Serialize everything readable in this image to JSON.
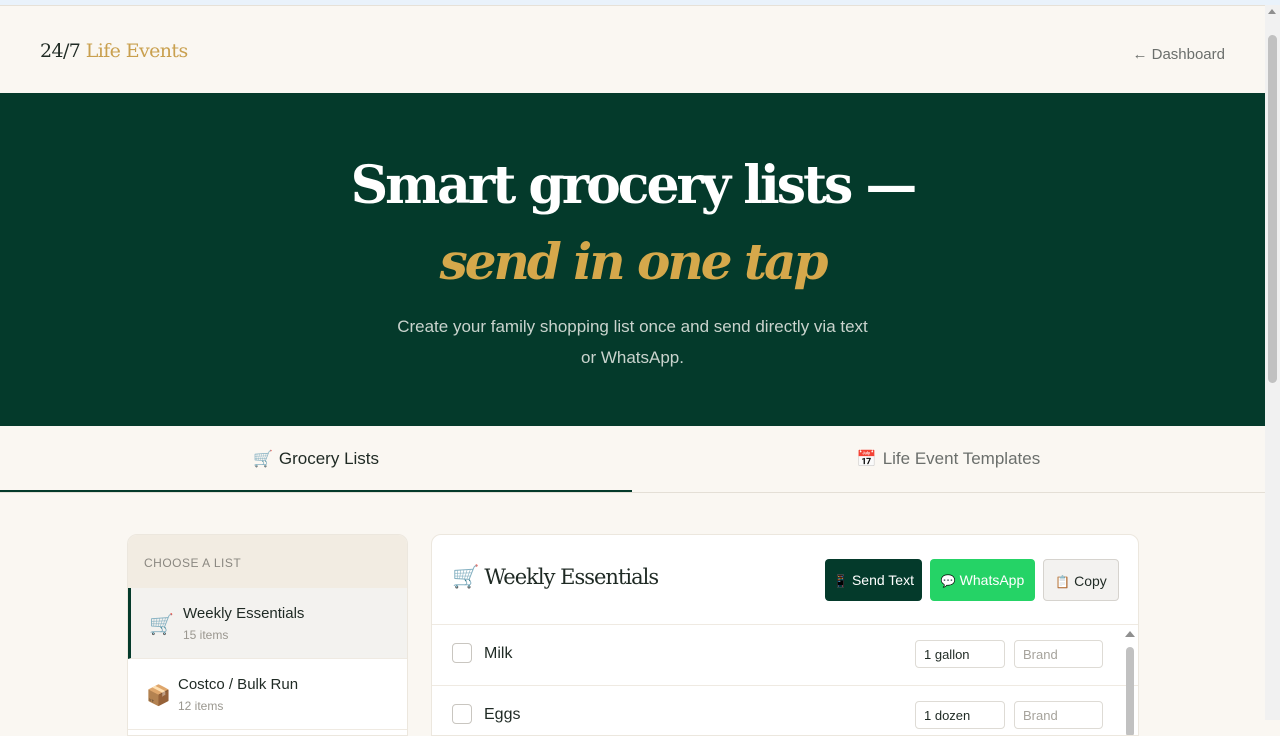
{
  "header": {
    "logo_brand": "24/7",
    "logo_rest": " Life Events",
    "dashboard_link": "← Dashboard"
  },
  "hero": {
    "title": "Smart grocery lists —",
    "subtitle": "send in one tap",
    "description": "Create your family shopping list once and send directly via text or WhatsApp."
  },
  "tabs": [
    {
      "icon": "🛒",
      "label": "Grocery Lists",
      "active": true
    },
    {
      "icon": "📅",
      "label": "Life Event Templates",
      "active": false
    }
  ],
  "sidebar": {
    "heading": "CHOOSE A LIST",
    "lists": [
      {
        "icon": "🛒",
        "name": "Weekly Essentials",
        "count": "15 items",
        "active": true
      },
      {
        "icon": "📦",
        "name": "Costco / Bulk Run",
        "count": "12 items",
        "active": false
      }
    ]
  },
  "panel": {
    "icon": "🛒",
    "title": "Weekly Essentials",
    "buttons": {
      "send_text": {
        "icon": "📱",
        "label": "Send Text"
      },
      "whatsapp": {
        "icon": "💬",
        "label": "WhatsApp"
      },
      "copy": {
        "icon": "📋",
        "label": "Copy"
      }
    },
    "brand_placeholder": "Brand",
    "items": [
      {
        "name": "Milk",
        "quantity": "1 gallon",
        "brand": "",
        "checked": false
      },
      {
        "name": "Eggs",
        "quantity": "1 dozen",
        "brand": "",
        "checked": false
      }
    ]
  },
  "colors": {
    "hero_bg": "#043a2b",
    "accent_gold": "#d5a84b",
    "whatsapp_green": "#25d366",
    "page_bg": "#faf7f2"
  }
}
